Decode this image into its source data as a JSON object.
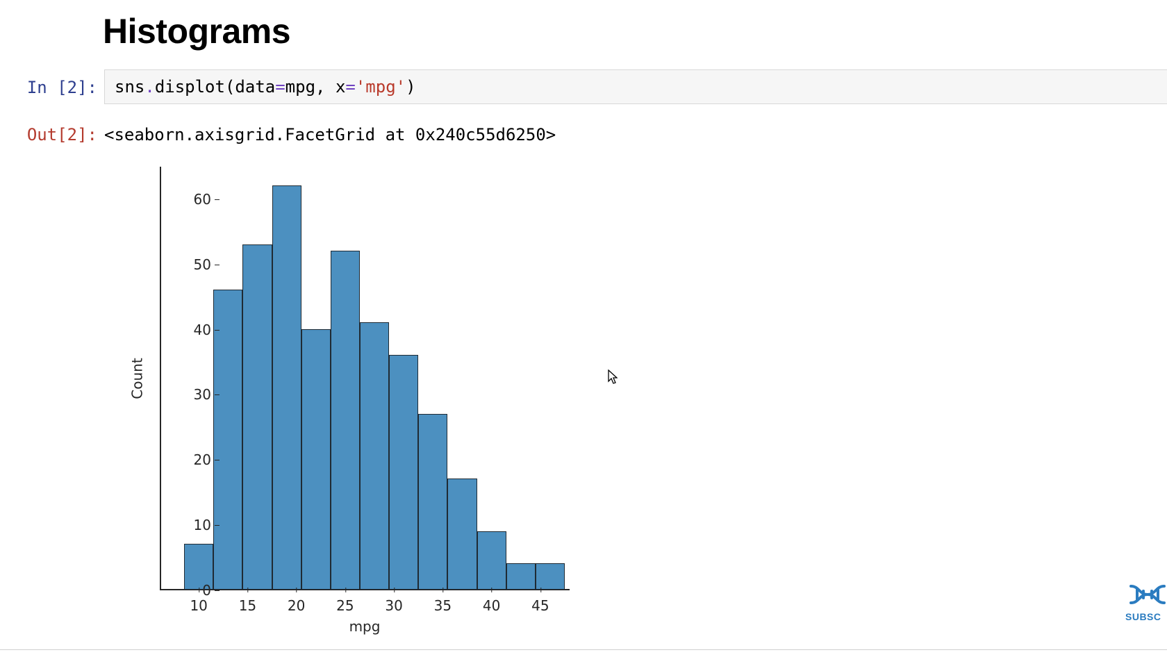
{
  "heading": "Histograms",
  "cell": {
    "in_prompt": "In [2]:",
    "out_prompt": "Out[2]:",
    "code": "sns.displot(data=mpg, x='mpg')",
    "code_tokens": {
      "t1": "sns",
      "t2": ".",
      "t3": "displot",
      "t4": "(",
      "t5": "data",
      "t6": "=",
      "t7": "mpg",
      "t8": ", ",
      "t9": "x",
      "t10": "=",
      "t11": "'mpg'",
      "t12": ")"
    },
    "output_text": "<seaborn.axisgrid.FacetGrid at 0x240c55d6250>"
  },
  "chart_data": {
    "type": "bar",
    "title": "",
    "xlabel": "mpg",
    "ylabel": "Count",
    "xlim": [
      6,
      48
    ],
    "ylim": [
      0,
      65
    ],
    "xticks": [
      10,
      15,
      20,
      25,
      30,
      35,
      40,
      45
    ],
    "yticks": [
      0,
      10,
      20,
      30,
      40,
      50,
      60
    ],
    "bin_edges": [
      8.5,
      11.5,
      14.5,
      17.5,
      20.5,
      23.5,
      26.5,
      29.5,
      32.5,
      35.5,
      38.5,
      41.5,
      44.5,
      47.5
    ],
    "values": [
      7,
      46,
      53,
      62,
      40,
      52,
      41,
      36,
      27,
      17,
      9,
      4,
      4
    ],
    "bar_color": "#4c90c0",
    "edge_color": "#1f2a33"
  },
  "watermark": {
    "label": "SUBSC"
  }
}
